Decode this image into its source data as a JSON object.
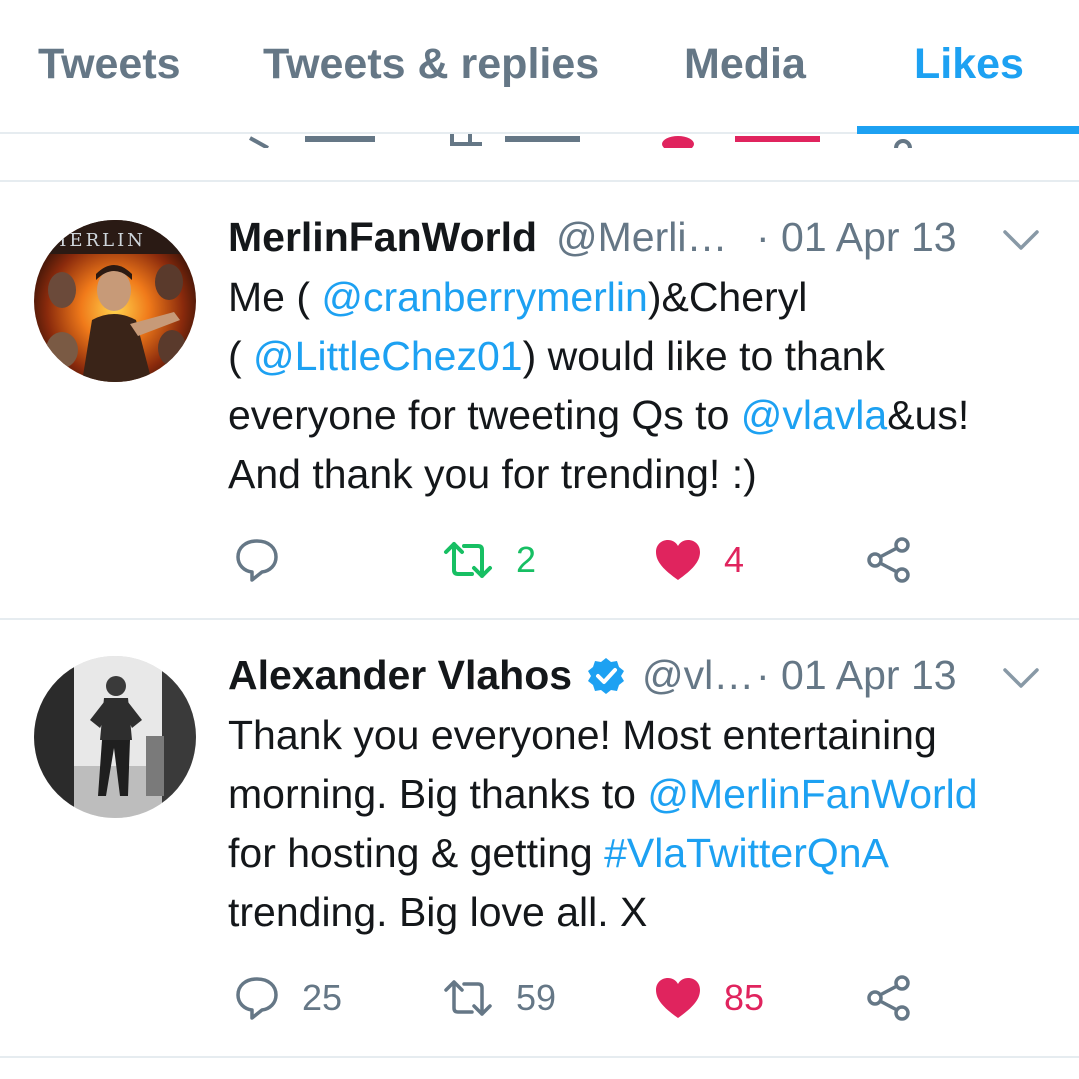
{
  "tabs": [
    {
      "label": "Tweets",
      "active": false
    },
    {
      "label": "Tweets & replies",
      "active": false
    },
    {
      "label": "Media",
      "active": false
    },
    {
      "label": "Likes",
      "active": true
    }
  ],
  "colors": {
    "accent": "#1da1f2",
    "muted": "#657786",
    "retweet": "#17bf63",
    "like": "#e0245e"
  },
  "tweets": [
    {
      "name": "MerlinFanWorld",
      "handle": "@Merli…",
      "date": "· 01 Apr 13",
      "verified": false,
      "avatar_icon": "merlin-avatar",
      "body_lines": [
        [
          {
            "t": "Me ( ",
            "link": false
          },
          {
            "t": "@cranberrymerlin",
            "link": true
          },
          {
            "t": ")&Cheryl",
            "link": false
          }
        ],
        [
          {
            "t": "( ",
            "link": false
          },
          {
            "t": "@LittleChez01",
            "link": true
          },
          {
            "t": ") would like to thank",
            "link": false
          }
        ],
        [
          {
            "t": "everyone for tweeting Qs to ",
            "link": false
          },
          {
            "t": "@vlavla",
            "link": true
          },
          {
            "t": "&us!",
            "link": false
          }
        ],
        [
          {
            "t": "And thank you for trending! :)",
            "link": false
          }
        ]
      ],
      "replies": "",
      "retweets": "2",
      "likes": "4",
      "liked": true,
      "retweeted": true
    },
    {
      "name": "Alexander Vlahos",
      "handle": "@vl…",
      "date": "· 01 Apr 13",
      "verified": true,
      "avatar_icon": "vlahos-avatar",
      "body_lines": [
        [
          {
            "t": "Thank you everyone! Most entertaining",
            "link": false
          }
        ],
        [
          {
            "t": "morning. Big thanks to ",
            "link": false
          },
          {
            "t": "@MerlinFanWorld",
            "link": true
          }
        ],
        [
          {
            "t": "for hosting & getting ",
            "link": false
          },
          {
            "t": "#VlaTwitterQnA",
            "link": true
          }
        ],
        [
          {
            "t": "trending. Big love all. X",
            "link": false
          }
        ]
      ],
      "replies": "25",
      "retweets": "59",
      "likes": "85",
      "liked": true,
      "retweeted": false
    }
  ]
}
